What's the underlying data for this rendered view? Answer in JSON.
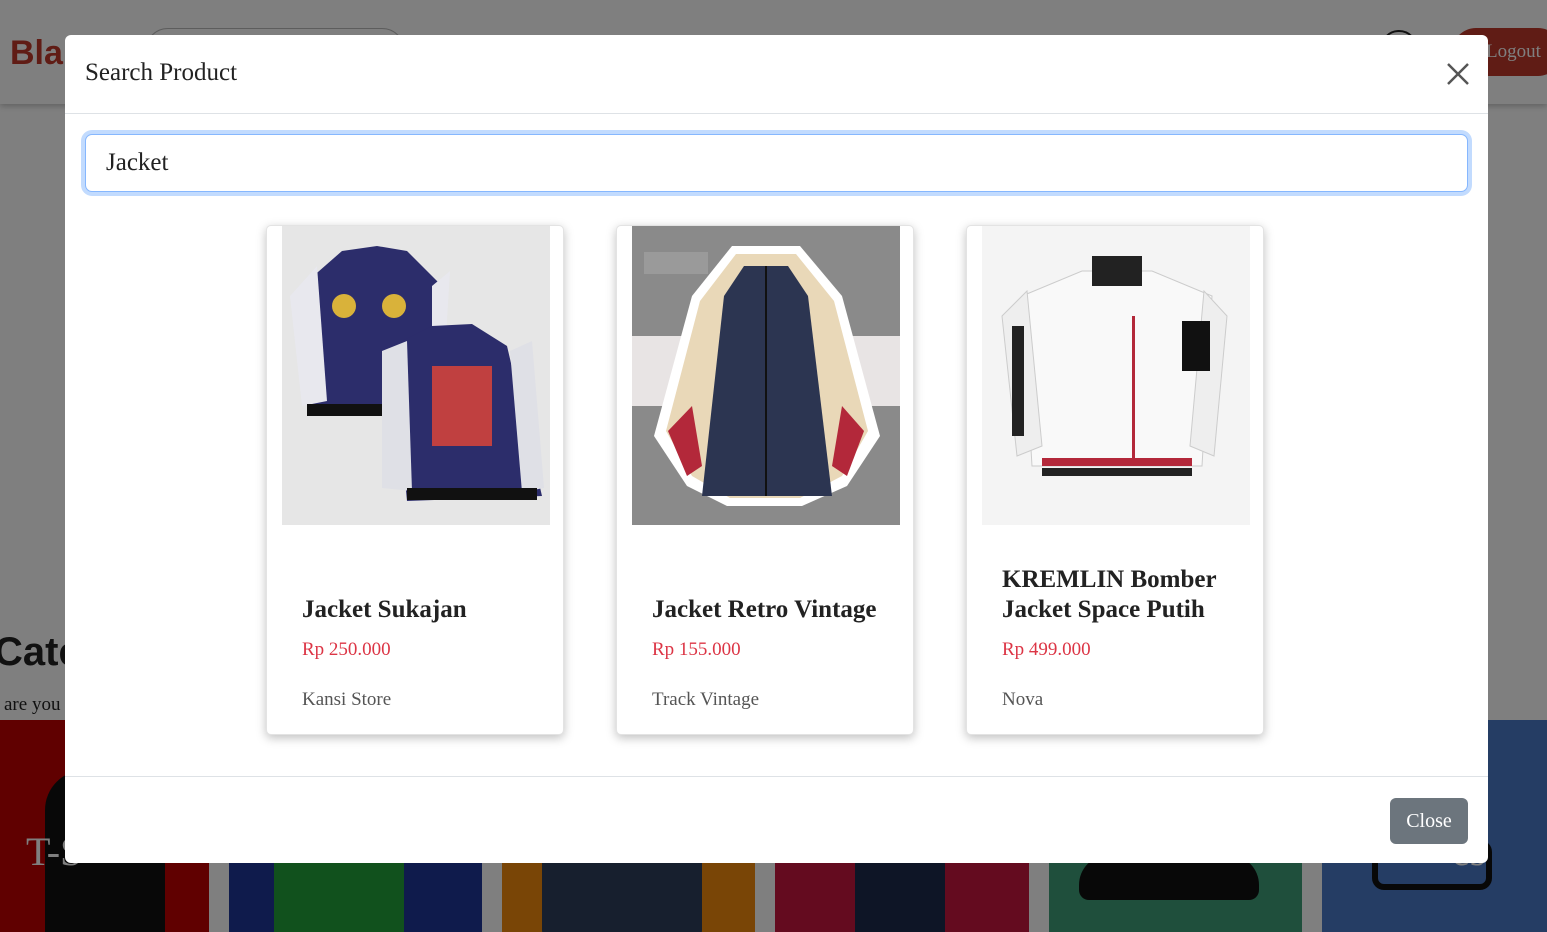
{
  "background": {
    "brand": "Bla",
    "logout_label": "Logout",
    "categories_heading": "Categ",
    "categories_subtitle": "are you",
    "category_tiles": [
      {
        "label": "T-S",
        "color": "#c00000"
      },
      {
        "label": "",
        "color": "#1f3799"
      },
      {
        "label": "",
        "color": "#f28b0c"
      },
      {
        "label": "",
        "color": "#c8173f"
      },
      {
        "label": "",
        "color": "#3f9e78"
      },
      {
        "label": "es",
        "color": "#4a7bc9"
      }
    ]
  },
  "modal": {
    "title": "Search Product",
    "search": {
      "value": "Jacket"
    },
    "close_label": "Close",
    "results": [
      {
        "name": "Jacket Sukajan",
        "price": "Rp 250.000",
        "store": "Kansi Store"
      },
      {
        "name": "Jacket Retro Vintage",
        "price": "Rp 155.000",
        "store": "Track Vintage"
      },
      {
        "name": "KREMLIN Bomber Jacket Space Putih",
        "price": "Rp 499.000",
        "store": "Nova"
      }
    ]
  },
  "colors": {
    "brand": "#c0392b",
    "price": "#dc3545",
    "close_button": "#6c757d",
    "focus_ring": "#86b7fe"
  }
}
